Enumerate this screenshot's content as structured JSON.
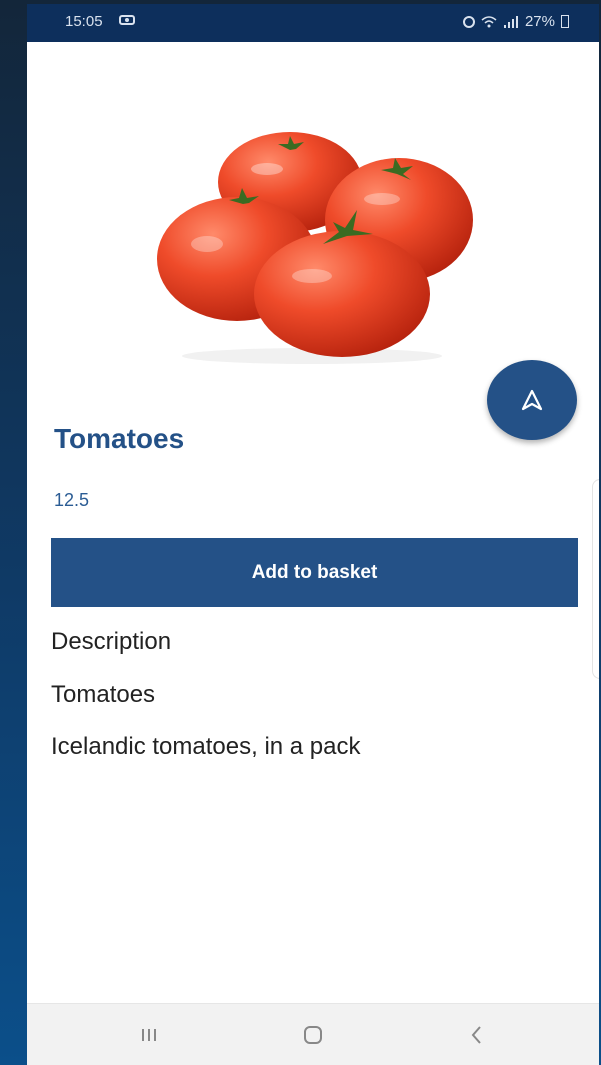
{
  "status_bar": {
    "time": "15:05",
    "battery": "27%"
  },
  "product": {
    "name": "Tomatoes",
    "price": "12.5",
    "image_icon": "tomatoes-image"
  },
  "actions": {
    "add_to_basket": "Add to basket",
    "fab_icon": "navigation-arrow-icon"
  },
  "description": {
    "heading": "Description",
    "name": "Tomatoes",
    "text": "Icelandic tomatoes, in a pack"
  },
  "nav_bar": {
    "recents_icon": "recents-icon",
    "home_icon": "home-icon",
    "back_icon": "back-icon"
  },
  "colors": {
    "accent": "#245187",
    "status_bar": "#0d2f5c",
    "tomato": "#e83a1f"
  }
}
